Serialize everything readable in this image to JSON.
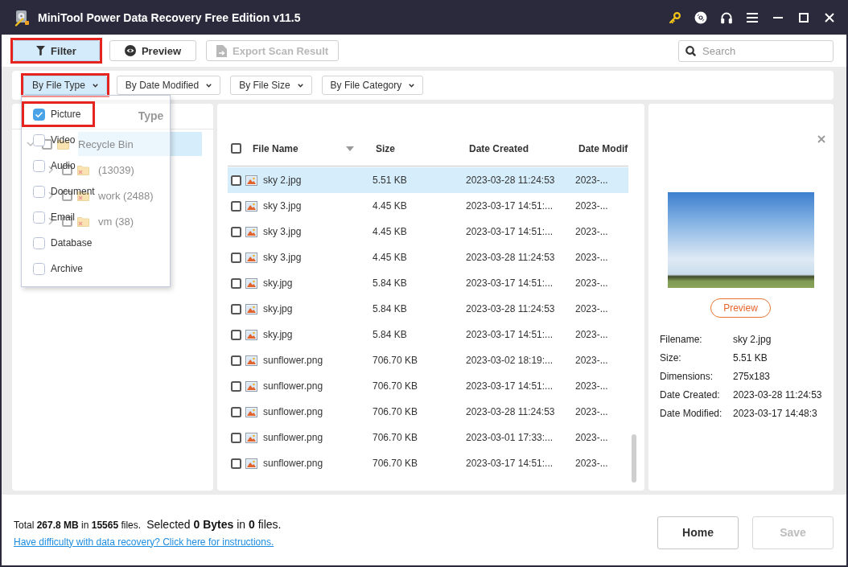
{
  "window": {
    "title": "MiniTool Power Data Recovery Free Edition v11.5"
  },
  "toolbar": {
    "buttons": [
      {
        "label": "Filter",
        "kind": "filter",
        "selected": true,
        "disabled": false,
        "highlighted": true
      },
      {
        "label": "Preview",
        "kind": "preview",
        "selected": false,
        "disabled": false,
        "highlighted": false
      },
      {
        "label": "Export Scan Result",
        "kind": "export",
        "selected": false,
        "disabled": true,
        "highlighted": false
      }
    ],
    "search": {
      "placeholder": "Search"
    }
  },
  "filters": [
    {
      "label": "By File Type",
      "selected": true,
      "highlighted": true
    },
    {
      "label": "By Date Modified",
      "selected": false,
      "highlighted": false
    },
    {
      "label": "By File Size",
      "selected": false,
      "highlighted": false
    },
    {
      "label": "By File Category",
      "selected": false,
      "highlighted": false
    }
  ],
  "file_type_menu": {
    "items": [
      {
        "label": "Picture",
        "checked": true,
        "highlighted": true
      },
      {
        "label": "Video",
        "checked": false,
        "highlighted": false
      },
      {
        "label": "Audio",
        "checked": false,
        "highlighted": false
      },
      {
        "label": "Document",
        "checked": false,
        "highlighted": false
      },
      {
        "label": "Email",
        "checked": false,
        "highlighted": false
      },
      {
        "label": "Database",
        "checked": false,
        "highlighted": false
      },
      {
        "label": "Archive",
        "checked": false,
        "highlighted": false
      }
    ]
  },
  "tree": {
    "tabs": [
      {
        "label": "Type",
        "selected": false
      }
    ],
    "items": [
      {
        "label": "Recycle Bin",
        "selected": true,
        "expanded": true,
        "checked": false,
        "deleted": false,
        "children": [
          {
            "label": "(13039)",
            "selected": false,
            "expanded": false,
            "checked": false,
            "deleted": true
          },
          {
            "label": "work (2488)",
            "selected": false,
            "expanded": false,
            "checked": false,
            "deleted": true
          },
          {
            "label": "vm (38)",
            "selected": false,
            "expanded": false,
            "checked": false,
            "deleted": true
          }
        ]
      }
    ]
  },
  "file_list": {
    "select_all": {
      "checked": false
    },
    "columns": [
      {
        "label": "File Name",
        "sorted": true
      },
      {
        "label": "Size",
        "sorted": false
      },
      {
        "label": "Date Created",
        "sorted": false
      },
      {
        "label": "Date Modif",
        "sorted": false
      }
    ],
    "rows": [
      {
        "name": "sky 2.jpg",
        "size": "5.51 KB",
        "date_created": "2023-03-28 11:24:53",
        "date_modified": "2023-...",
        "selected": true,
        "checked": false
      },
      {
        "name": "sky 3.jpg",
        "size": "4.45 KB",
        "date_created": "2023-03-17 14:51:...",
        "date_modified": "2023-...",
        "selected": false,
        "checked": false
      },
      {
        "name": "sky 3.jpg",
        "size": "4.45 KB",
        "date_created": "2023-03-17 14:51:...",
        "date_modified": "2023-...",
        "selected": false,
        "checked": false
      },
      {
        "name": "sky 3.jpg",
        "size": "4.45 KB",
        "date_created": "2023-03-28 11:24:53",
        "date_modified": "2023-...",
        "selected": false,
        "checked": false
      },
      {
        "name": "sky.jpg",
        "size": "5.84 KB",
        "date_created": "2023-03-17 14:51:...",
        "date_modified": "2023-...",
        "selected": false,
        "checked": false
      },
      {
        "name": "sky.jpg",
        "size": "5.84 KB",
        "date_created": "2023-03-28 11:24:53",
        "date_modified": "2023-...",
        "selected": false,
        "checked": false
      },
      {
        "name": "sky.jpg",
        "size": "5.84 KB",
        "date_created": "2023-03-17 14:51:...",
        "date_modified": "2023-...",
        "selected": false,
        "checked": false
      },
      {
        "name": "sunflower.png",
        "size": "706.70 KB",
        "date_created": "2023-03-02 18:19:...",
        "date_modified": "2023-...",
        "selected": false,
        "checked": false
      },
      {
        "name": "sunflower.png",
        "size": "706.70 KB",
        "date_created": "2023-03-17 14:51:...",
        "date_modified": "2023-...",
        "selected": false,
        "checked": false
      },
      {
        "name": "sunflower.png",
        "size": "706.70 KB",
        "date_created": "2023-03-28 11:24:53",
        "date_modified": "2023-...",
        "selected": false,
        "checked": false
      },
      {
        "name": "sunflower.png",
        "size": "706.70 KB",
        "date_created": "2023-03-01 17:33:...",
        "date_modified": "2023-...",
        "selected": false,
        "checked": false
      },
      {
        "name": "sunflower.png",
        "size": "706.70 KB",
        "date_created": "2023-03-17 14:51:...",
        "date_modified": "2023-...",
        "selected": false,
        "checked": false
      }
    ]
  },
  "preview": {
    "button": "Preview",
    "details": [
      {
        "label": "Filename:",
        "value": "sky 2.jpg"
      },
      {
        "label": "Size:",
        "value": "5.51 KB"
      },
      {
        "label": "Dimensions:",
        "value": "275x183"
      },
      {
        "label": "Date Created:",
        "value": "2023-03-28 11:24:53"
      },
      {
        "label": "Date Modified:",
        "value": "2023-03-17 14:48:3"
      }
    ]
  },
  "status": {
    "total": "Total **267.8 MB** in **15565** files.",
    "selected": "Selected **0 Bytes** in **0** files.",
    "help_link": "Have difficulty with data recovery? Click here for instructions."
  },
  "actions": [
    {
      "label": "Home",
      "disabled": false
    },
    {
      "label": "Save",
      "disabled": true
    }
  ]
}
